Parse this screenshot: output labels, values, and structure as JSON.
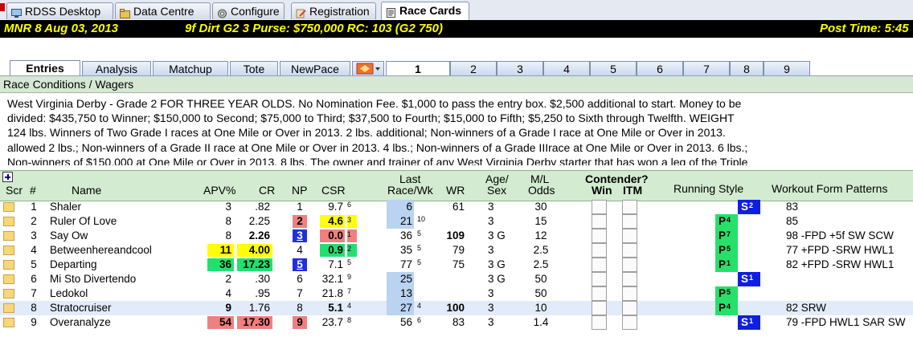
{
  "window_tabs": [
    {
      "label": "RDSS Desktop",
      "icon": "desktop-icon"
    },
    {
      "label": "Data Centre",
      "icon": "folder-icon"
    },
    {
      "label": "Configure",
      "icon": "gear-icon"
    },
    {
      "label": "Registration",
      "icon": "pen-icon"
    },
    {
      "label": "Race Cards",
      "icon": "document-icon"
    }
  ],
  "header": {
    "track_date": "MNR  8  Aug 03, 2013",
    "race_info": "9f  Dirt   G2  3   Purse: $750,000   RC: 103  (G2 750)",
    "post_time": "Post Time: 5:45"
  },
  "sub_tabs": [
    "Entries",
    "Analysis",
    "Matchup",
    "Tote",
    "NewPace"
  ],
  "race_numbers": [
    "1",
    "2",
    "3",
    "4",
    "5",
    "6",
    "7",
    "8",
    "9"
  ],
  "race_conditions": {
    "title": "Race Conditions / Wagers",
    "lines": [
      "West Virginia Derby - Grade 2 FOR THREE YEAR OLDS. No Nomination Fee. $1,000 to pass the entry box. $2,500 additional to start. Money to be",
      "divided: $435,750 to Winner; $150,000 to Second; $75,000 to Third; $37,500 to Fourth; $15,000 to Fifth; $5,250 to Sixth through Twelfth. WEIGHT",
      "124 lbs. Winners of Two Grade I races at One Mile or Over in 2013. 2 lbs. additional; Non-winners of a Grade I race at One Mile or Over in 2013.",
      "allowed 2 lbs.; Non-winners of a Grade II race at One Mile or Over in 2013. 4 lbs.; Non-winners of a Grade IIIrace at One Mile or Over in 2013. 6 lbs.;",
      "Non-winners of $150,000 at One Mile or Over in 2013. 8 lbs. The owner and trainer of any West Virginia Derby starter that has won a leg of the Triple"
    ]
  },
  "columns": {
    "scr": "Scr",
    "num": "#",
    "name": "Name",
    "apv": "APV%",
    "cr": "CR",
    "np": "NP",
    "csr": "CSR",
    "last_race_1": "Last",
    "last_race_2": "Race/Wk",
    "wr": "WR",
    "age_1": "Age/",
    "age_2": "Sex",
    "ml_1": "M/L",
    "ml_2": "Odds",
    "contender": "Contender?",
    "win": "Win",
    "itm": "ITM",
    "running_style": "Running Style",
    "workout": "Workout Form Patterns"
  },
  "entries": [
    {
      "num": "1",
      "name": "Shaler",
      "apv": "3",
      "cr": ".82",
      "np": "1",
      "csr": "9.7",
      "csr_rank": "6",
      "last": "6",
      "wk": "",
      "wr": "61",
      "age": "3",
      "ml": "30",
      "rs": "S",
      "rs_n": "2",
      "work": "83"
    },
    {
      "num": "2",
      "name": "Ruler Of Love",
      "apv": "8",
      "cr": "2.25",
      "np": "2",
      "csr": "4.6",
      "csr_rank": "3",
      "last": "21",
      "wk": "10",
      "wr": "",
      "age": "3",
      "ml": "15",
      "rs": "P",
      "rs_n": "4",
      "work": "85"
    },
    {
      "num": "3",
      "name": "Say Ow",
      "apv": "8",
      "cr": "2.26",
      "np": "3",
      "csr": "0.0",
      "csr_rank": "1",
      "last": "36",
      "wk": "5",
      "wr": "109",
      "age": "3 G",
      "ml": "12",
      "rs": "P",
      "rs_n": "7",
      "work": "98  -FPD  +5f  SW  SCW"
    },
    {
      "num": "4",
      "name": "Betweenhereandcool",
      "apv": "11",
      "cr": "4.00",
      "np": "4",
      "csr": "0.9",
      "csr_rank": "2",
      "last": "35",
      "wk": "5",
      "wr": "79",
      "age": "3",
      "ml": "2.5",
      "rs": "P",
      "rs_n": "5",
      "work": "77  +FPD  -SRW  HWL1"
    },
    {
      "num": "5",
      "name": "Departing",
      "apv": "36",
      "cr": "17.23",
      "np": "5",
      "csr": "7.1",
      "csr_rank": "5",
      "last": "77",
      "wk": "5",
      "wr": "75",
      "age": "3 G",
      "ml": "2.5",
      "rs": "P",
      "rs_n": "1",
      "work": "82  +FPD  -SRW  HWL1"
    },
    {
      "num": "6",
      "name": "Mi Sto Divertendo",
      "apv": "2",
      "cr": ".30",
      "np": "6",
      "csr": "32.1",
      "csr_rank": "9",
      "last": "25",
      "wk": "",
      "wr": "",
      "age": "3 G",
      "ml": "50",
      "rs": "S",
      "rs_n": "1",
      "work": ""
    },
    {
      "num": "7",
      "name": "Ledokol",
      "apv": "4",
      "cr": ".95",
      "np": "7",
      "csr": "21.8",
      "csr_rank": "7",
      "last": "13",
      "wk": "",
      "wr": "",
      "age": "3",
      "ml": "50",
      "rs": "P",
      "rs_n": "5",
      "work": ""
    },
    {
      "num": "8",
      "name": "Stratocruiser",
      "apv": "9",
      "cr": "1.76",
      "np": "8",
      "csr": "5.1",
      "csr_rank": "4",
      "last": "27",
      "wk": "4",
      "wr": "100",
      "age": "3",
      "ml": "10",
      "rs": "P",
      "rs_n": "4",
      "work": "82  SRW"
    },
    {
      "num": "9",
      "name": "Overanalyze",
      "apv": "54",
      "cr": "17.30",
      "np": "9",
      "csr": "23.7",
      "csr_rank": "8",
      "last": "56",
      "wk": "6",
      "wr": "83",
      "age": "3",
      "ml": "1.4",
      "rs": "S",
      "rs_n": "1",
      "work": "79  -FPD  HWL1  SAR  SW"
    }
  ],
  "colors": {
    "yellow": "#ffff00",
    "green": "#22e070",
    "salmon": "#f08080",
    "blue": "#1f2fe0",
    "light_blue": "#b9d3f0",
    "header_green": "#d3ebd0"
  }
}
